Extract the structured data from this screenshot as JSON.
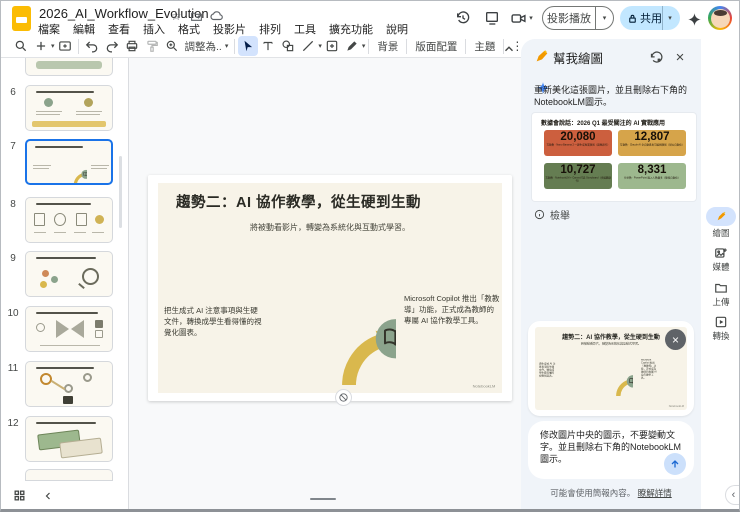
{
  "titlebar": {
    "doc_title": "2026_AI_Workflow_Evolution",
    "menus": [
      "檔案",
      "編輯",
      "查看",
      "插入",
      "格式",
      "投影片",
      "排列",
      "工具",
      "擴充功能",
      "說明"
    ],
    "present_label": "投影播放",
    "share_label": "共用"
  },
  "toolbar": {
    "fit_label": "調整為..",
    "bg_label": "背景",
    "layout_label": "版面配置",
    "theme_label": "主題"
  },
  "filmstrip": {
    "numbers": [
      6,
      7,
      8,
      9,
      10,
      11,
      12
    ]
  },
  "slide": {
    "title": "趨勢二：AI 協作教學，從生硬到生動",
    "subtitle": "將被動看影片，轉變為系統化與互動式學習。",
    "left_note": "把生成式 AI 注意事項與生硬文件，轉換成學生看得懂的視覺化圖表。",
    "right_note": "Microsoft Copilot 推出「教教導」功能，正式成為教師的專屬 AI 協作教學工具。",
    "watermark": "NotebookLM"
  },
  "panel": {
    "title": "幫我繪圖",
    "prompt": "重新美化這張圖片，並且刪除右下角的 NotebookLM圖示。",
    "stats_title": "數據會說話：2026 Q1 最受關注的 AI 實戰應用",
    "stats": [
      {
        "value": "20,080",
        "note": "互動數 · Nano Banana 2 一鍵生成專業簡報（圖像創作）"
      },
      {
        "value": "12,807",
        "note": "互動數 · Claude AI 全自動產出可編輯簡報（辦公自動化）"
      },
      {
        "value": "10,727",
        "note": "互動數 · NotebookLM + Canva 打造 Storyboard（多媒體創作）"
      },
      {
        "value": "8,331",
        "note": "分享數 · PowerPoint 匯入人數最多（簡報自動化）"
      }
    ],
    "report_label": "檢舉",
    "card_title": "趨勢二：AI 協作教學，從生硬到生動",
    "card_subtitle": "將被動看影片，轉變為系統化與互動式學習。",
    "input_text": "修改圖片中央的圖示，不要變動文字。並且刪除右下角的NotebookLM圖示。",
    "disclaimer": "可能會使用簡報內容。",
    "learn_more": "瞭解詳情"
  },
  "strip": {
    "draw": "繪圖",
    "media": "媒體",
    "upload": "上傳",
    "convert": "轉換"
  },
  "colors": {
    "accent_blue": "#1a73e8",
    "share_pill": "#c2e7ff",
    "panel_bg": "#f0f4f9",
    "slide_cream": "#f7f3e8",
    "diagram_green": "#8ba38c",
    "diagram_yellow": "#d9b84d",
    "diagram_salmon": "#dd8168",
    "stat_red": "#cc5f3e",
    "stat_amber": "#d6a44a",
    "stat_dark_green": "#657d52",
    "stat_light_green": "#9db88e"
  }
}
